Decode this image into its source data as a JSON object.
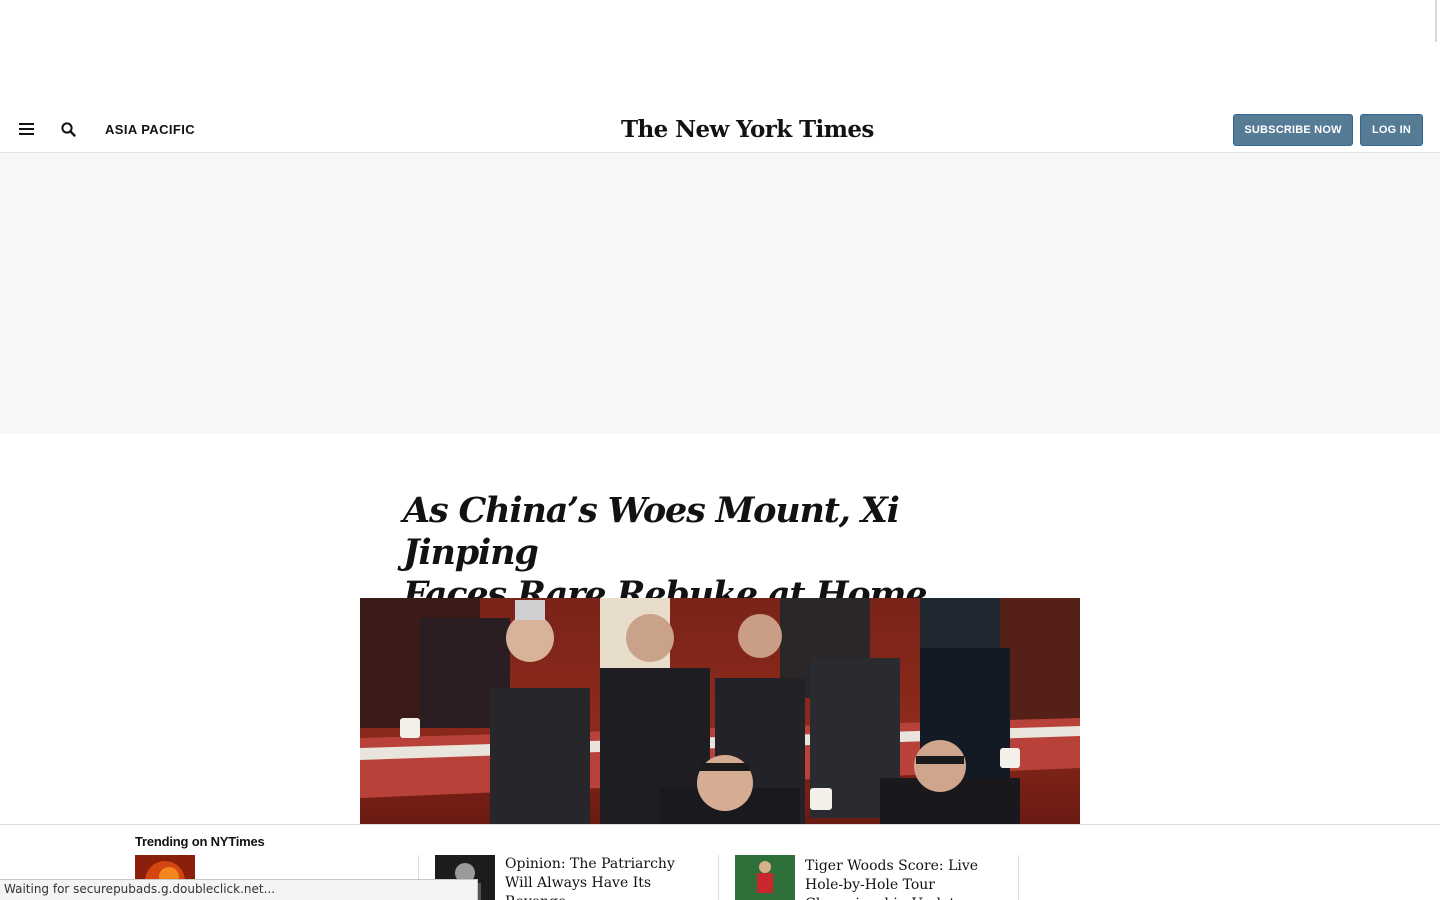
{
  "header": {
    "section": "ASIA PACIFIC",
    "logo": "The New York Times",
    "subscribe_label": "SUBSCRIBE NOW",
    "login_label": "LOG IN"
  },
  "article": {
    "headline_line1": "As China’s Woes Mount, Xi Jinping",
    "headline_line2": "Faces Rare Rebuke at Home"
  },
  "trending": {
    "title": "Trending on NYTimes",
    "items": [
      {
        "text": ""
      },
      {
        "text": "Opinion: The Patriarchy Will Always Have Its Revenge"
      },
      {
        "text": "Tiger Woods Score: Live Hole-by-Hole Tour Championship Updates"
      }
    ]
  },
  "status_bar": {
    "text": "Waiting for securepubads.g.doubleclick.net..."
  },
  "colors": {
    "button_bg": "#567b95",
    "ad_band": "#f7f7f7",
    "divider": "#e2e2e2"
  }
}
